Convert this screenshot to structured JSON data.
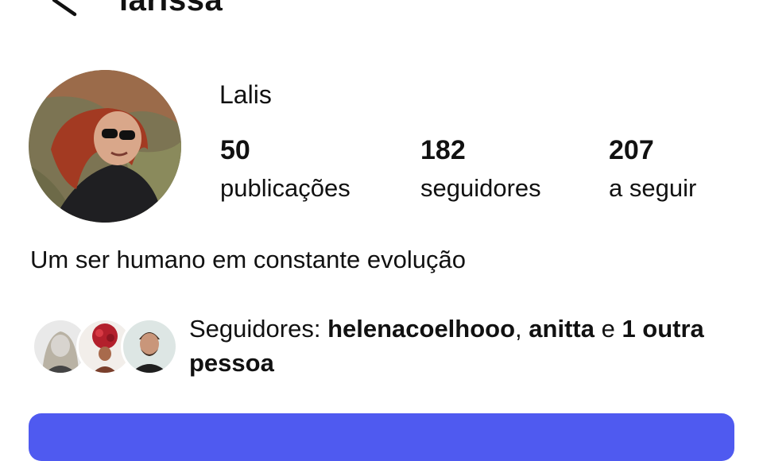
{
  "header": {
    "username": "larissa",
    "back_icon": "back-arrow-icon",
    "more_icon": "more-options-icon"
  },
  "profile": {
    "display_name": "Lalis",
    "stats": [
      {
        "value": "50",
        "label": "publicações"
      },
      {
        "value": "182",
        "label": "seguidores"
      },
      {
        "value": "207",
        "label": "a seguir"
      }
    ],
    "bio": "Um ser humano em constante evolução"
  },
  "mutual": {
    "prefix": "Seguidores: ",
    "names": [
      "helenacoelhooo",
      "anitta"
    ],
    "separator": ", ",
    "conjunction": " e ",
    "others": "1 outra pessoa"
  },
  "colors": {
    "accent": "#4f5af0",
    "text": "#111111",
    "background": "#ffffff"
  }
}
